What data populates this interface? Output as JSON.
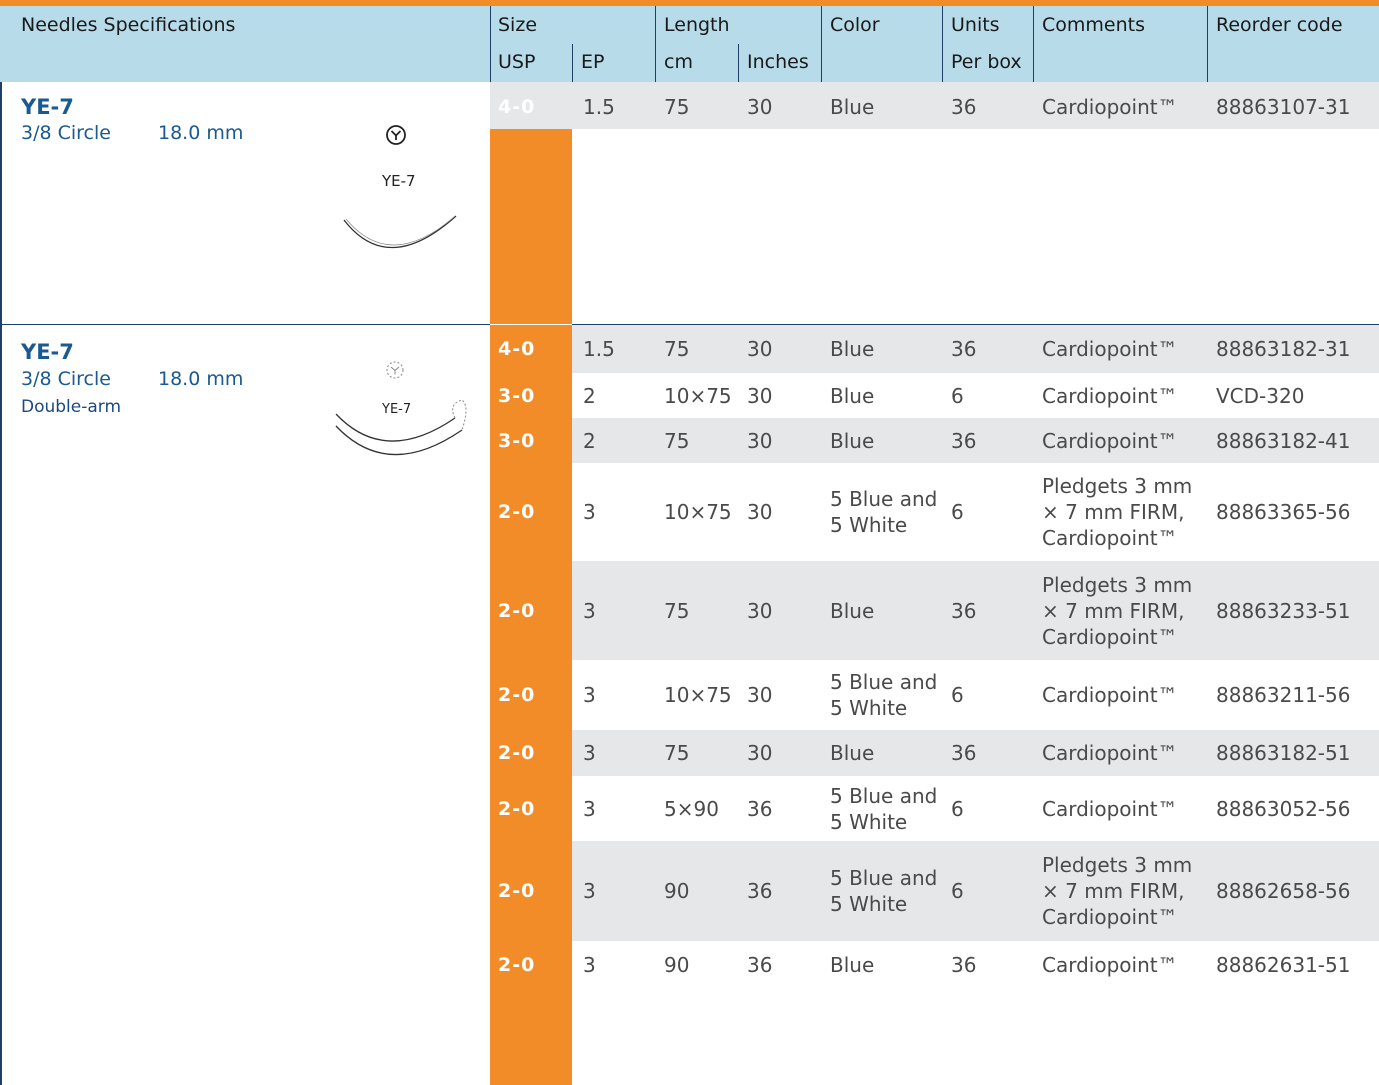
{
  "header": {
    "needles": "Needles Specifications",
    "size": "Size",
    "usp": "USP",
    "ep": "EP",
    "length": "Length",
    "cm": "cm",
    "inches": "Inches",
    "color": "Color",
    "units": "Units",
    "per_box": "Per box",
    "comments": "Comments",
    "reorder": "Reorder code"
  },
  "section1": {
    "name": "YE-7",
    "circle": "3/8 Circle",
    "length": "18.0 mm",
    "needle_label": "YE-7",
    "rows": [
      {
        "usp": "4-0",
        "ep": "1.5",
        "cm": "75",
        "inches": "30",
        "color": "Blue",
        "units": "36",
        "comments": "Cardiopoint™",
        "code": "88863107-31"
      }
    ]
  },
  "section2": {
    "name": "YE-7",
    "circle": "3/8 Circle",
    "length": "18.0 mm",
    "arm": "Double-arm",
    "needle_label": "YE-7",
    "rows": [
      {
        "usp": "4-0",
        "ep": "1.5",
        "cm": "75",
        "inches": "30",
        "color": "Blue",
        "units": "36",
        "comments": "Cardiopoint™",
        "code": "88863182-31"
      },
      {
        "usp": "3-0",
        "ep": "2",
        "cm": "10×75",
        "inches": "30",
        "color": "Blue",
        "units": "6",
        "comments": "Cardiopoint™",
        "code": "VCD-320"
      },
      {
        "usp": "3-0",
        "ep": "2",
        "cm": "75",
        "inches": "30",
        "color": "Blue",
        "units": "36",
        "comments": "Cardiopoint™",
        "code": "88863182-41"
      },
      {
        "usp": "2-0",
        "ep": "3",
        "cm": "10×75",
        "inches": "30",
        "color1": "5 Blue and",
        "color2": "5 White",
        "units": "6",
        "c1": "Pledgets 3 mm",
        "c2": "× 7 mm FIRM,",
        "c3": "Cardiopoint™",
        "code": "88863365-56"
      },
      {
        "usp": "2-0",
        "ep": "3",
        "cm": "75",
        "inches": "30",
        "color": "Blue",
        "units": "36",
        "c1": "Pledgets 3 mm",
        "c2": "× 7 mm FIRM,",
        "c3": "Cardiopoint™",
        "code": "88863233-51"
      },
      {
        "usp": "2-0",
        "ep": "3",
        "cm": "10×75",
        "inches": "30",
        "color1": "5 Blue and",
        "color2": "5 White",
        "units": "6",
        "comments": "Cardiopoint™",
        "code": "88863211-56"
      },
      {
        "usp": "2-0",
        "ep": "3",
        "cm": "75",
        "inches": "30",
        "color": "Blue",
        "units": "36",
        "comments": "Cardiopoint™",
        "code": "88863182-51"
      },
      {
        "usp": "2-0",
        "ep": "3",
        "cm": "5×90",
        "inches": "36",
        "color1": "5 Blue and",
        "color2": "5 White",
        "units": "6",
        "comments": "Cardiopoint™",
        "code": "88863052-56"
      },
      {
        "usp": "2-0",
        "ep": "3",
        "cm": "90",
        "inches": "36",
        "color1": "5 Blue and",
        "color2": "5 White",
        "units": "6",
        "c1": "Pledgets 3 mm",
        "c2": "× 7 mm FIRM,",
        "c3": "Cardiopoint™",
        "code": "88862658-56"
      },
      {
        "usp": "2-0",
        "ep": "3",
        "cm": "90",
        "inches": "36",
        "color": "Blue",
        "units": "36",
        "comments": "Cardiopoint™",
        "code": "88862631-51"
      }
    ]
  },
  "colors": {
    "accent": "#f28c28",
    "header_bg": "#b7dbe8",
    "title": "#1a5a92",
    "shade": "#e6e7e8"
  }
}
